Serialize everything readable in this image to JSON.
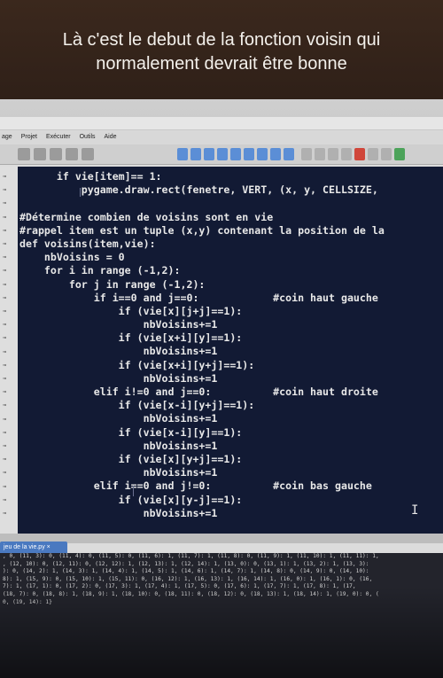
{
  "caption": {
    "text": "Là c'est le debut de la fonction voisin qui normalement devrait être bonne"
  },
  "menu": {
    "items": [
      "age",
      "Projet",
      "Exécuter",
      "Outils",
      "Aide"
    ]
  },
  "editor": {
    "lines": [
      "      if vie[item]== 1:",
      "          pygame.draw.rect(fenetre, VERT, (x, y, CELLSIZE,",
      "",
      "#Détermine combien de voisins sont en vie",
      "#rappel item est un tuple (x,y) contenant la position de la",
      "def voisins(item,vie):",
      "    nbVoisins = 0",
      "    for i in range (-1,2):",
      "        for j in range (-1,2):",
      "            if i==0 and j==0:            #coin haut gauche",
      "                if (vie[x][j+j]==1):",
      "                    nbVoisins+=1",
      "                if (vie[x+i][y]==1):",
      "                    nbVoisins+=1",
      "                if (vie[x+i][y+j]==1):",
      "                    nbVoisins+=1",
      "            elif i!=0 and j==0:          #coin haut droite",
      "                if (vie[x-i][y+j]==1):",
      "                    nbVoisins+=1",
      "                if (vie[x-i][y]==1):",
      "                    nbVoisins+=1",
      "                if (vie[x][y+j]==1):",
      "                    nbVoisins+=1",
      "            elif i==0 and j!=0:          #coin bas gauche",
      "                if (vie[x][y-j]==1):",
      "                    nbVoisins+=1"
    ]
  },
  "console": {
    "tab_label": "jeu de la vie.py ×",
    "lines": [
      ", 0, (11, 3): 0, (11, 4): 0, (11, 5): 0, (11, 6): 1, (11, 7): 1, (11, 8): 0, (11, 9): 1, (11, 10): 1, (11, 11): 1,",
      ", (12, 10): 0, (12, 11): 0, (12, 12): 1, (12, 13): 1, (12, 14): 1, (13, 0): 0, (13, 1): 1, (13, 2): 1, (13, 3):",
      "): 0, (14, 2): 1, (14, 3): 1, (14, 4): 1, (14, 5): 1, (14, 6): 1, (14, 7): 1, (14, 8): 0, (14, 9): 0, (14, 10):",
      "8): 1, (15, 9): 0, (15, 10): 1, (15, 11): 0, (16, 12): 1, (16, 13): 1, (16, 14): 1, (16, 0): 1, (16, 1): 0, (16,",
      "7): 1, (17, 1): 0, (17, 2): 0, (17, 3): 1, (17, 4): 1, (17, 5): 0, (17, 6): 1, (17, 7): 1, (17, 8): 1, (17,",
      "(18, 7): 0, (18, 8): 1, (18, 9): 1, (18, 10): 0, (18, 11): 0, (18, 12): 0, (18, 13): 1, (18, 14): 1, (19, 0): 0, (",
      "0, (19, 14): 1}"
    ]
  },
  "colors": {
    "editor_bg": "#121a34",
    "caption_bg": "#3b281d",
    "tab_accent": "#4a79c0"
  }
}
